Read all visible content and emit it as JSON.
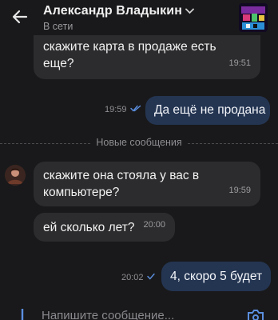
{
  "header": {
    "contact_name": "Александр Владыкин",
    "status": "В сети"
  },
  "messages": [
    {
      "direction": "in",
      "text": "скажите карта в продаже есть еще?",
      "time": "19:51"
    },
    {
      "direction": "out",
      "text": "Да ещё не продана",
      "time": "19:59",
      "read": true
    },
    {
      "direction": "in",
      "text": "скажите она стояла у вас в компьютере?",
      "time": "19:59"
    },
    {
      "direction": "in",
      "text": "ей сколько лет?",
      "time": "20:00"
    },
    {
      "direction": "out",
      "text": "4, скоро 5 будет",
      "time": "20:02",
      "read": false
    }
  ],
  "divider": {
    "label": "Новые сообщения"
  },
  "composer": {
    "placeholder": "Напишите сообщение..."
  },
  "colors": {
    "background": "#19191b",
    "incoming_bubble": "#2c2c2e",
    "outgoing_bubble": "#243552",
    "accent": "#5b8fe0"
  },
  "icons": [
    "back-arrow-icon",
    "chevron-down-icon",
    "check-icon",
    "double-check-icon",
    "attach-icon",
    "camera-icon"
  ]
}
